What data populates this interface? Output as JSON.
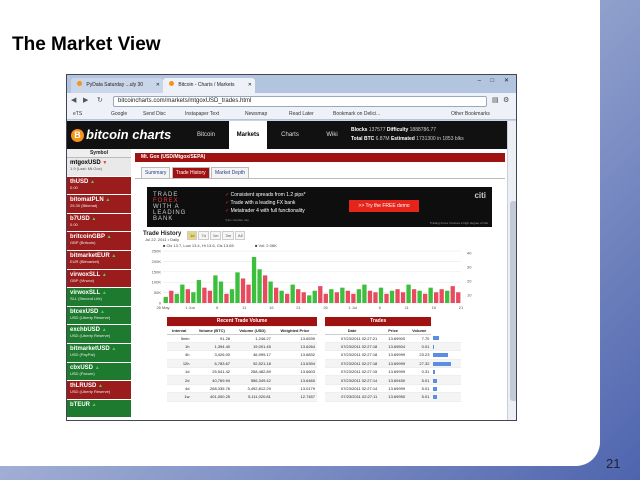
{
  "slide": {
    "title": "The Market View",
    "number": "21"
  },
  "browser": {
    "tabs": [
      {
        "label": "PyData Saturday ...uly 30",
        "active": false
      },
      {
        "label": "Bitcoin - Charts / Markets",
        "active": true
      }
    ],
    "window_controls": "– □ ✕",
    "nav": {
      "back": "◀",
      "forward": "▶",
      "reload": "↻"
    },
    "url": "bitcoincharts.com/markets/mtgoxUSD_trades.html",
    "bookmarks": [
      "eTS",
      "Google",
      "Send Disc",
      "Instapaper Text",
      "Newsmap",
      "Read Later",
      "Bookmark on Delici...",
      "Other Bookmarks"
    ]
  },
  "site": {
    "logo": "bitcoin charts",
    "logo_glyph": "B",
    "nav": [
      {
        "label": "Bitcoin",
        "active": false
      },
      {
        "label": "Markets",
        "active": true
      },
      {
        "label": "Charts",
        "active": false
      },
      {
        "label": "Wiki",
        "active": false
      }
    ],
    "ticker": {
      "blocks_label": "Blocks",
      "blocks_value": "137577",
      "difficulty_label": "Difficulty",
      "difficulty_value": "1888786.77",
      "total_label": "Total BTC",
      "total_value": "6.87M",
      "estimated_label": "Estimated",
      "estimated_value": "1731300 in 1853 blks",
      "time": "Jul 23 2011 02:27:32 (UTC)",
      "blocks_suffix": "Bloc"
    }
  },
  "sidebar": {
    "heading": "Symbol",
    "items": [
      {
        "symbol": "mtgoxUSD",
        "sub": "1.9 (Last: Mt.Gox)",
        "trend": "down",
        "style": "first"
      },
      {
        "symbol": "thUSD",
        "sub": "0.00",
        "trend": "up",
        "style": "red"
      },
      {
        "symbol": "bitomatPLN",
        "sub": "25.30 (Bitomat)",
        "trend": "up",
        "style": "red"
      },
      {
        "symbol": "b7USD",
        "sub": "0.00",
        "trend": "up",
        "style": "red"
      },
      {
        "symbol": "britcoinGBP",
        "sub": "GBP (Britcoin)",
        "trend": "up",
        "style": "red"
      },
      {
        "symbol": "bitmarketEUR",
        "sub": "EUR (Bitmarket)",
        "trend": "up",
        "style": "red"
      },
      {
        "symbol": "virwoxSLL",
        "sub": "GBP (Virwox)",
        "trend": "up",
        "style": "red"
      },
      {
        "symbol": "virwoxSLL",
        "sub": "SLL (Second Life)",
        "trend": "up",
        "style": "green"
      },
      {
        "symbol": "btcexUSD",
        "sub": "USD (Liberty Reserve)",
        "trend": "up",
        "style": "green"
      },
      {
        "symbol": "exchbUSD",
        "sub": "USD (Liberty Reserve)",
        "trend": "up",
        "style": "green"
      },
      {
        "symbol": "bitmarketUSD",
        "sub": "USD (PayPal)",
        "trend": "up",
        "style": "green"
      },
      {
        "symbol": "cbxUSD",
        "sub": "USD (Paxum)",
        "trend": "up",
        "style": "green"
      },
      {
        "symbol": "thLRUSD",
        "sub": "USD (Liberty Reserve)",
        "trend": "up",
        "style": "red"
      },
      {
        "symbol": "bTEUR",
        "sub": "",
        "trend": "up",
        "style": "green"
      }
    ]
  },
  "market": {
    "title": "Mt. Gox (USD/Mtgox/SEPA)",
    "subtabs": [
      {
        "label": "Summary",
        "active": false
      },
      {
        "label": "Trade History",
        "active": true
      },
      {
        "label": "Market Depth",
        "active": false
      }
    ]
  },
  "ad": {
    "brand_lines": [
      "TRADE",
      "FOREX",
      "WITH A",
      "LEADING",
      "BANK"
    ],
    "points": [
      "Consistent spreads from 1.2 pips*",
      "Trade with a leading FX bank",
      "Metatrader 4 with full functionality"
    ],
    "check_glyph": "✓",
    "disclaimer": "*plus variable rate",
    "cta": ">> Try the FREE demo",
    "advertiser": "citi",
    "footer": "Trading Forex involves a high degree of risk"
  },
  "chart": {
    "title": "Trade History",
    "zoom_buttons": [
      "1d",
      "7d",
      "1m",
      "3m",
      "All"
    ],
    "zoom_active": 0,
    "date_label": "Jul 22, 2011 • Daily",
    "legend_left": "■ Cls 13.7, Low 13.4, Hi 13.6, Cls 13.65",
    "legend_right": "■ Vol: 2.06K"
  },
  "chart_data": {
    "type": "bar",
    "title": "Trade History",
    "x_ticks": [
      "26 May",
      "1 Jun",
      "6",
      "11",
      "16",
      "21",
      "26",
      "1 Jul",
      "6",
      "11",
      "16",
      "21"
    ],
    "y_left_ticks": [
      "250K",
      "200K",
      "150K",
      "100K",
      "50K",
      "0"
    ],
    "y_right_ticks": [
      "40",
      "30",
      "20",
      "10"
    ],
    "series": [
      {
        "name": "Vol",
        "values": [
          4,
          8,
          6,
          12,
          9,
          7,
          15,
          10,
          8,
          18,
          14,
          6,
          9,
          20,
          16,
          12,
          30,
          22,
          18,
          14,
          10,
          8,
          6,
          12,
          9,
          7,
          5,
          8,
          11,
          6,
          9,
          7,
          10,
          8,
          6,
          9,
          12,
          8,
          7,
          10,
          6,
          8,
          9,
          7,
          12,
          9,
          8,
          6,
          10,
          7,
          9,
          8,
          11,
          7
        ]
      }
    ],
    "gains": [
      1,
      0,
      1,
      1,
      0,
      1,
      1,
      0,
      0,
      1,
      1,
      0,
      1,
      1,
      0,
      0,
      1,
      1,
      0,
      1,
      0,
      1,
      0,
      1,
      0,
      0,
      1,
      1,
      0,
      0,
      1,
      0,
      1,
      0,
      0,
      1,
      1,
      0,
      0,
      1,
      0,
      1,
      0,
      0,
      1,
      0,
      1,
      0,
      1,
      0,
      0,
      1,
      0,
      0
    ]
  },
  "recent_volume": {
    "title": "Recent Trade Volume",
    "headers": [
      "Interval",
      "Volume (BTC)",
      "Volume (USD)",
      "Weighted Price"
    ],
    "rows": [
      [
        "5min",
        "91.28",
        "1,246.27",
        "13.6539"
      ],
      [
        "1h",
        "1,394.40",
        "19,001.45",
        "13.6264"
      ],
      [
        "4h",
        "3,426.00",
        "46,999.17",
        "13.6832"
      ],
      [
        "12h",
        "6,783.67",
        "92,521.18",
        "13.6394"
      ],
      [
        "1d",
        "25,541.42",
        "258,482.89",
        "13.6603"
      ],
      [
        "2d",
        "40,769.94",
        "556,349.42",
        "13.6460"
      ],
      [
        "4d",
        "268,335.76",
        "3,492,812.29",
        "13.0179"
      ],
      [
        "1w",
        "401,000.25",
        "5,111,020.81",
        "12.7457"
      ]
    ]
  },
  "trades": {
    "title": "Trades",
    "headers": [
      "Date",
      "Price",
      "Volume"
    ],
    "rows": [
      [
        "07/23/2011 02:27:21",
        "13.69900",
        "7.70",
        12
      ],
      [
        "07/23/2011 02:27:18",
        "13.69504",
        "0.01",
        2
      ],
      [
        "07/23/2011 02:27:18",
        "13.69999",
        "23.23",
        30
      ],
      [
        "07/23/2011 02:27:18",
        "13.69999",
        "27.32",
        36
      ],
      [
        "07/23/2011 02:27:15",
        "13.69999",
        "0.31",
        4
      ],
      [
        "07/23/2011 02:27:14",
        "13.69450",
        "5.01",
        8
      ],
      [
        "07/23/2011 02:27:14",
        "13.69999",
        "5.01",
        8
      ],
      [
        "07/23/2011 02:27:11",
        "13.69950",
        "5.01",
        8
      ]
    ]
  }
}
